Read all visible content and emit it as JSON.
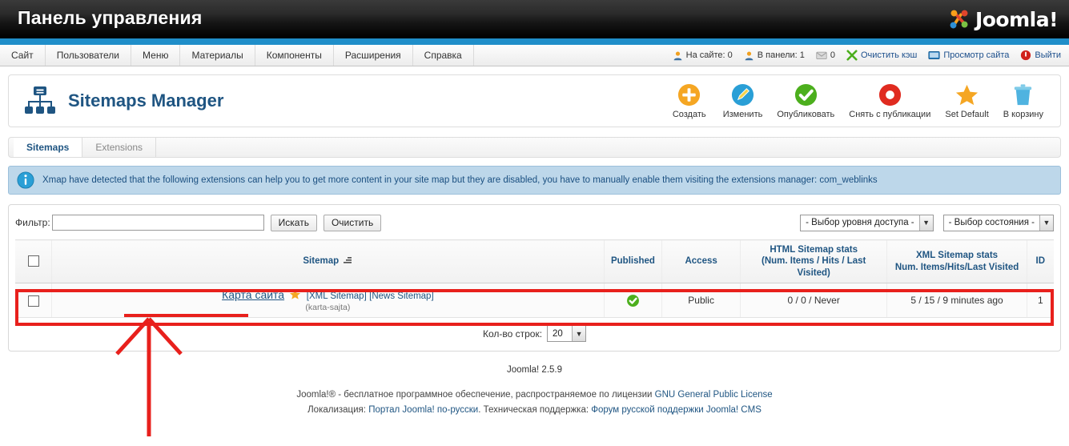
{
  "header": {
    "title": "Панель управления",
    "brand": "Joomla!",
    "brand_icon": "joomla-logo-icon"
  },
  "menu": {
    "items": [
      {
        "label": "Сайт"
      },
      {
        "label": "Пользователи"
      },
      {
        "label": "Меню"
      },
      {
        "label": "Материалы"
      },
      {
        "label": "Компоненты"
      },
      {
        "label": "Расширения"
      },
      {
        "label": "Справка"
      }
    ]
  },
  "status": {
    "items": [
      {
        "icon": "visitors-icon",
        "label": "На сайте: 0"
      },
      {
        "icon": "admins-icon",
        "label": "В панели: 1"
      },
      {
        "icon": "messages-icon",
        "label": "0"
      },
      {
        "icon": "clear-cache-icon",
        "label": "Очистить кэш"
      },
      {
        "icon": "preview-site-icon",
        "label": "Просмотр сайта"
      },
      {
        "icon": "logout-icon",
        "label": "Выйти"
      }
    ]
  },
  "page": {
    "title": "Sitemaps Manager",
    "title_icon": "sitemap-icon"
  },
  "toolbar": {
    "buttons": [
      {
        "label": "Создать",
        "icon": "plus-circle-icon",
        "color": "#f5a623"
      },
      {
        "label": "Изменить",
        "icon": "pencil-circle-icon",
        "color": "#2a9fd6"
      },
      {
        "label": "Опубликовать",
        "icon": "check-circle-icon",
        "color": "#4caf1d"
      },
      {
        "label": "Снять с публикации",
        "icon": "unpublish-circle-icon",
        "color": "#e02b20"
      },
      {
        "label": "Set Default",
        "icon": "star-icon",
        "color": "#f5a623"
      },
      {
        "label": "В корзину",
        "icon": "trash-icon",
        "color": "#4fb3e0"
      }
    ]
  },
  "tabs": [
    {
      "label": "Sitemaps",
      "active": true
    },
    {
      "label": "Extensions",
      "active": false
    }
  ],
  "message": {
    "icon": "info-icon",
    "text": "Xmap have detected that the following extensions can help you to get more content in your site map but they are disabled, you have to manually enable them visiting the extensions manager: com_weblinks"
  },
  "filter": {
    "label": "Фильтр:",
    "value": "",
    "placeholder": "",
    "search_button": "Искать",
    "clear_button": "Очистить",
    "access_select": "- Выбор уровня доступа -",
    "state_select": "- Выбор состояния -"
  },
  "table": {
    "columns": [
      {
        "key": "check",
        "label": ""
      },
      {
        "key": "sitemap",
        "label": "Sitemap",
        "sort_icon": "sort-asc-icon"
      },
      {
        "key": "published",
        "label": "Published"
      },
      {
        "key": "access",
        "label": "Access"
      },
      {
        "key": "html_stats",
        "label": "HTML Sitemap stats",
        "sub": "(Num. Items / Hits / Last Visited)"
      },
      {
        "key": "xml_stats",
        "label": "XML Sitemap stats",
        "sub": "Num. Items/Hits/Last Visited"
      },
      {
        "key": "id",
        "label": "ID"
      }
    ],
    "rows": [
      {
        "name": "Карта сайта",
        "default_icon": "star-icon",
        "links": [
          {
            "label": "[XML Sitemap]"
          },
          {
            "label": "[News Sitemap]"
          }
        ],
        "alias": "(karta-sajta)",
        "published_icon": "check-circle-icon",
        "access": "Public",
        "html_stats": "0 / 0 / Never",
        "xml_stats": "5 / 15 / 9 minutes ago",
        "id": "1"
      }
    ]
  },
  "pagination": {
    "label": "Кол-во строк:",
    "value": "20"
  },
  "footer": {
    "version": "Joomla! 2.5.9",
    "line1_pre": "Joomla!® - бесплатное программное обеспечение, распространяемое по лицензии ",
    "line1_link": "GNU General Public License",
    "line2_pre": "Локализация: ",
    "line2_link1": "Портал Joomla! по-русски",
    "line2_mid": ". Техническая поддержка: ",
    "line2_link2": "Форум русской поддержки Joomla! CMS"
  },
  "annotations": {
    "highlight_color": "#e8201c"
  }
}
